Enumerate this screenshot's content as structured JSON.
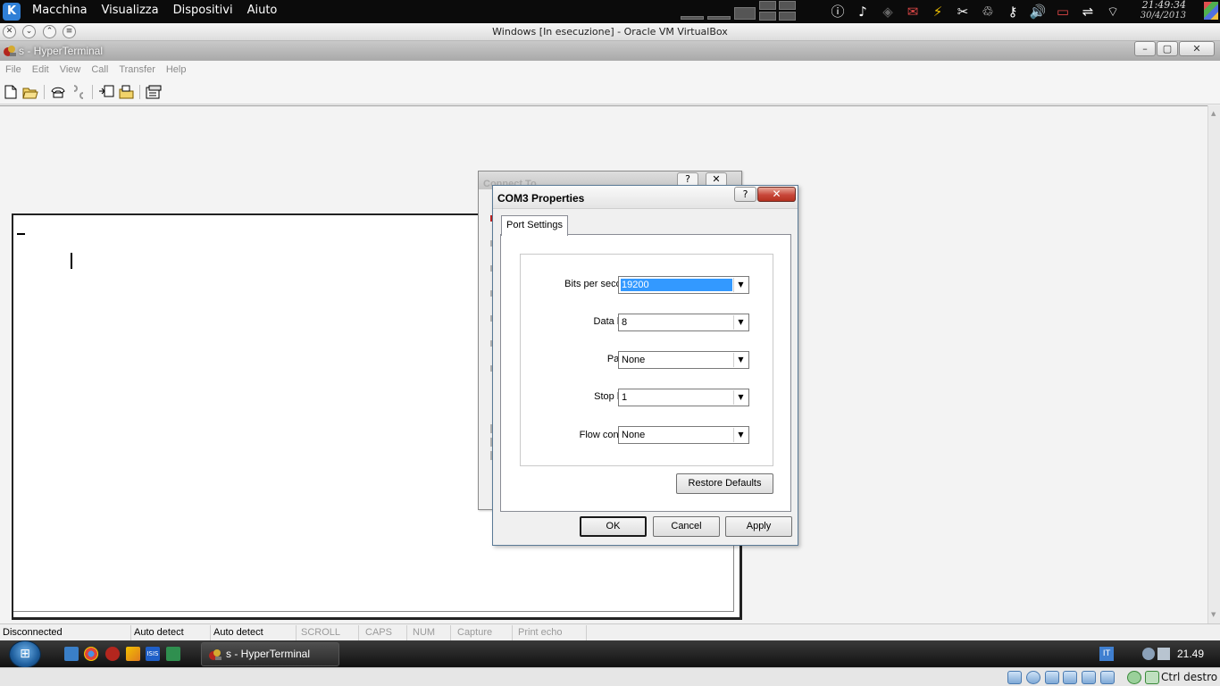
{
  "host_panel": {
    "menu": [
      "Macchina",
      "Visualizza",
      "Dispositivi",
      "Aiuto"
    ],
    "clock_time": "21:49:34",
    "clock_date": "30/4/2013"
  },
  "vbox_window": {
    "title": "Windows [In esecuzione] - Oracle VM VirtualBox"
  },
  "hyperterminal": {
    "title": "s - HyperTerminal",
    "menu": [
      "File",
      "Edit",
      "View",
      "Call",
      "Transfer",
      "Help"
    ],
    "status": {
      "connection": "Disconnected",
      "detect1": "Auto detect",
      "detect2": "Auto detect",
      "scroll": "SCROLL",
      "caps": "CAPS",
      "num": "NUM",
      "capture": "Capture",
      "print_echo": "Print echo"
    }
  },
  "connect_dialog": {
    "title": "Connect To"
  },
  "com3_dialog": {
    "title": "COM3 Properties",
    "tab": "Port Settings",
    "fields": {
      "bits_per_second": {
        "label": "Bits per second:",
        "value": "19200"
      },
      "data_bits": {
        "label": "Data bits:",
        "value": "8"
      },
      "parity": {
        "label": "Parity:",
        "value": "None"
      },
      "stop_bits": {
        "label": "Stop bits:",
        "value": "1"
      },
      "flow_control": {
        "label": "Flow control:",
        "value": "None"
      }
    },
    "restore_defaults": "Restore Defaults",
    "ok": "OK",
    "cancel": "Cancel",
    "apply": "Apply"
  },
  "taskbar": {
    "task_label": "s - HyperTerminal",
    "language": "IT",
    "time": "21.49"
  },
  "vbox_status": {
    "host_key": "Ctrl destro"
  },
  "colors": {
    "selection": "#3399ff",
    "close_button": "#c8473a",
    "host_panel_bg": "#0b0b0b"
  }
}
